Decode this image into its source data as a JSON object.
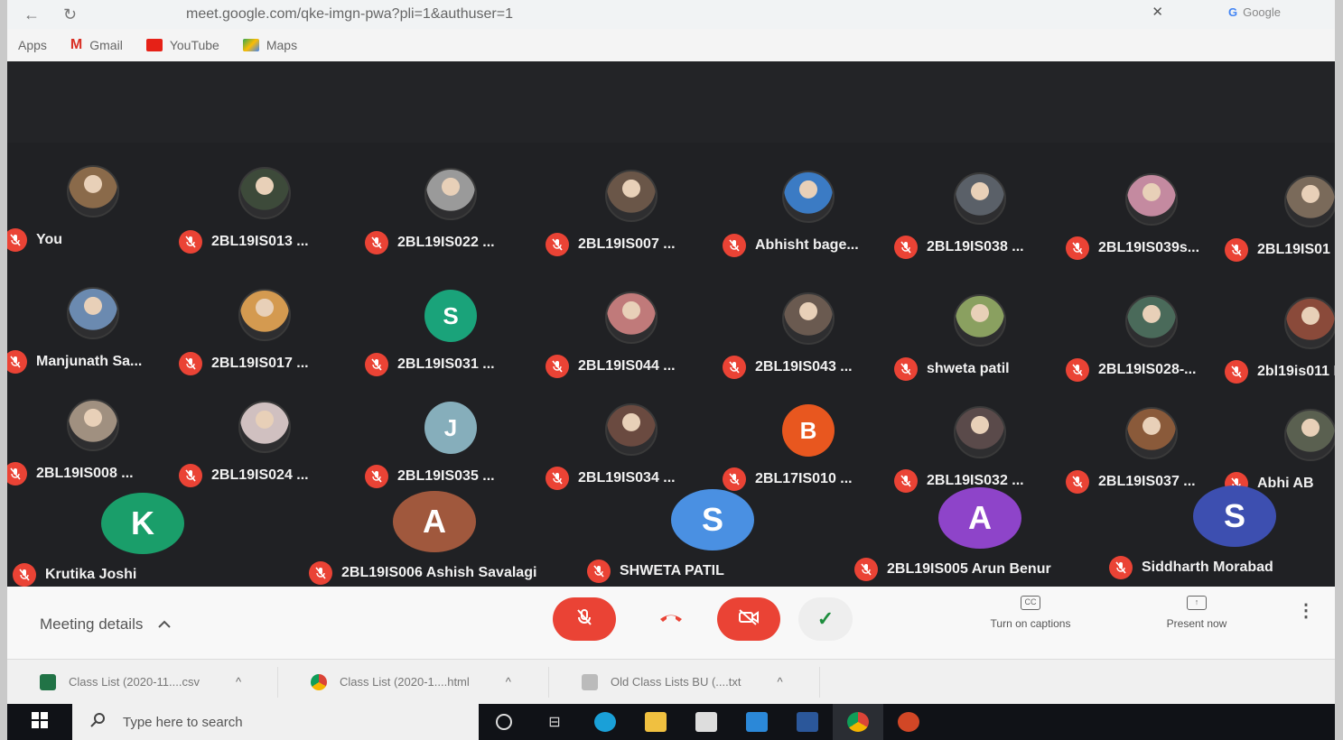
{
  "browser": {
    "url": "meet.google.com/qke-imgn-pwa?pli=1&authuser=1",
    "google_tab": "Google",
    "bookmarks": [
      {
        "label": "Apps",
        "icon": "apps-grid-icon",
        "color": ""
      },
      {
        "label": "Gmail",
        "icon": "gmail-icon",
        "color": "#d93025"
      },
      {
        "label": "YouTube",
        "icon": "youtube-icon",
        "color": "#e62117"
      },
      {
        "label": "Maps",
        "icon": "maps-icon",
        "color": "#34a853"
      }
    ]
  },
  "participants": [
    {
      "name": "You",
      "avatar": "photo",
      "color": "#8a6a4a"
    },
    {
      "name": "2BL19IS013 ...",
      "avatar": "photo",
      "color": "#3d4a3a"
    },
    {
      "name": "2BL19IS022 ...",
      "avatar": "photo",
      "color": "#9a9a9a"
    },
    {
      "name": "2BL19IS007 ...",
      "avatar": "photo",
      "color": "#6a5648"
    },
    {
      "name": "Abhisht bage...",
      "avatar": "photo",
      "color": "#3b7bc4"
    },
    {
      "name": "2BL19IS038 ...",
      "avatar": "photo",
      "color": "#5a6068"
    },
    {
      "name": "2BL19IS039s...",
      "avatar": "photo",
      "color": "#c48aa0"
    },
    {
      "name": "2BL19IS01",
      "avatar": "photo",
      "color": "#7a6a5a"
    },
    {
      "name": "Manjunath Sa...",
      "avatar": "photo",
      "color": "#6b8ab0"
    },
    {
      "name": "2BL19IS017 ...",
      "avatar": "photo",
      "color": "#d49a50"
    },
    {
      "name": "2BL19IS031 ...",
      "avatar": "S",
      "color": "#1aa37a"
    },
    {
      "name": "2BL19IS044 ...",
      "avatar": "photo",
      "color": "#c07a7a"
    },
    {
      "name": "2BL19IS043 ...",
      "avatar": "photo",
      "color": "#6a5a50"
    },
    {
      "name": "shweta patil",
      "avatar": "photo",
      "color": "#8aa060"
    },
    {
      "name": "2BL19IS028-...",
      "avatar": "photo",
      "color": "#4a6a5a"
    },
    {
      "name": "2bl19is011 I",
      "avatar": "photo",
      "color": "#8a4a3a"
    },
    {
      "name": "2BL19IS008 ...",
      "avatar": "photo",
      "color": "#a09080"
    },
    {
      "name": "2BL19IS024 ...",
      "avatar": "photo",
      "color": "#d0c0c0"
    },
    {
      "name": "2BL19IS035 ...",
      "avatar": "J",
      "color": "#86aebb"
    },
    {
      "name": "2BL19IS034 ...",
      "avatar": "photo",
      "color": "#6a4a40"
    },
    {
      "name": "2BL17IS010 ...",
      "avatar": "B",
      "color": "#e8571f"
    },
    {
      "name": "2BL19IS032 ...",
      "avatar": "photo",
      "color": "#5a4a4a"
    },
    {
      "name": "2BL19IS037 ...",
      "avatar": "photo",
      "color": "#8a5a3a"
    },
    {
      "name": "Abhi AB",
      "avatar": "photo",
      "color": "#5a6050"
    }
  ],
  "featured": [
    {
      "name": "Krutika Joshi",
      "avatar": "K",
      "color": "#1a9e6a"
    },
    {
      "name": "2BL19IS006 Ashish Savalagi",
      "avatar": "A",
      "color": "#a0583d"
    },
    {
      "name": "SHWETA PATIL",
      "avatar": "S",
      "color": "#4a90e2"
    },
    {
      "name": "2BL19IS005 Arun Benur",
      "avatar": "A",
      "color": "#8e44c9"
    },
    {
      "name": "Siddharth Morabad",
      "avatar": "S",
      "color": "#3d4fb0"
    }
  ],
  "controls": {
    "meeting_details": "Meeting details",
    "captions": "Turn on captions",
    "present": "Present now",
    "captions_icon": "CC"
  },
  "downloads": [
    {
      "label": "Class List (2020-11....csv",
      "icon": "csv-file-icon",
      "color": "#217346"
    },
    {
      "label": "Class List (2020-1....html",
      "icon": "chrome-icon",
      "color": "#db4437"
    },
    {
      "label": "Old Class Lists BU (....txt",
      "icon": "text-file-icon",
      "color": "#999999"
    }
  ],
  "taskbar": {
    "search_placeholder": "Type here to search"
  }
}
